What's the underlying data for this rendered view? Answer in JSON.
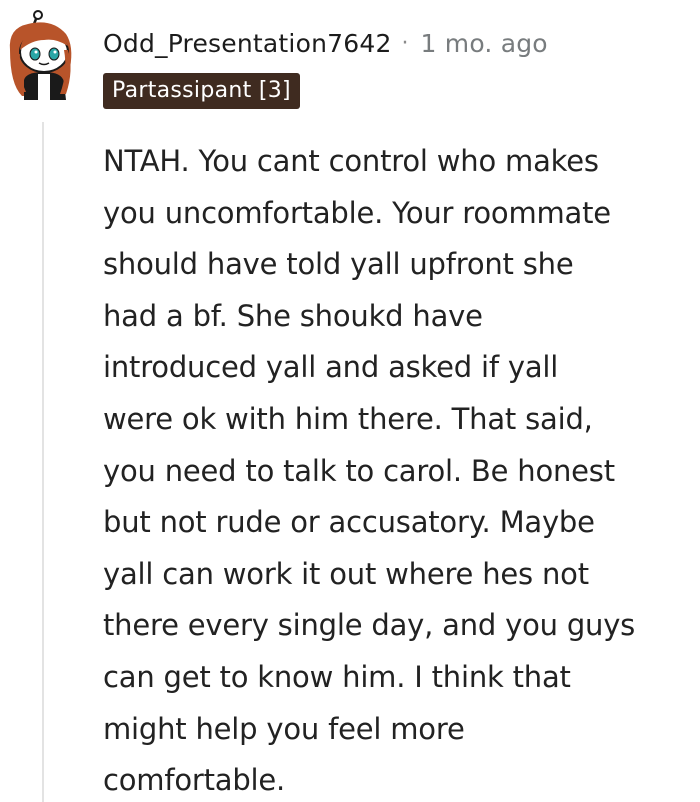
{
  "comment": {
    "username": "Odd_Presentation7642",
    "separator": "·",
    "timestamp": "1 mo. ago",
    "flair": "Partassipant [3]",
    "avatar_icon": "snoo-avatar-icon",
    "colors": {
      "flair_bg": "#3f2b20",
      "flair_text": "#ffffff",
      "avatar_hair": "#b8542a",
      "avatar_eyes": "#2aa6a6"
    },
    "body_lines": [
      "NTAH. You cant control who makes",
      "you uncomfortable. Your roommate",
      "should have told yall upfront she",
      "had a bf. She shoukd have",
      "introduced yall and asked if yall",
      "were ok with him there. That said,",
      "you need to talk to carol. Be honest",
      "but not rude or accusatory. Maybe",
      "yall can work it out where hes not",
      "there every single day, and you guys",
      "can get to know him. I think that",
      "might help you feel more",
      "comfortable."
    ]
  }
}
